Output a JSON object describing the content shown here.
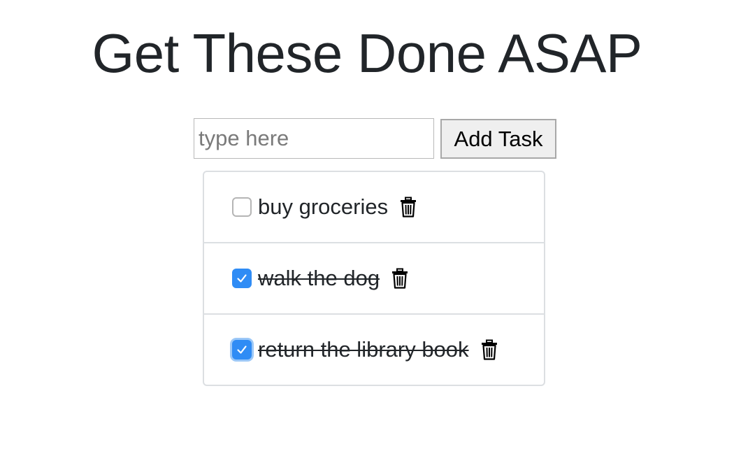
{
  "page": {
    "title": "Get These Done ASAP"
  },
  "form": {
    "input_value": "",
    "input_placeholder": "type here",
    "add_button_label": "Add Task"
  },
  "tasks": [
    {
      "label": "buy groceries",
      "completed": false,
      "delete_icon": "trash-icon"
    },
    {
      "label": "walk the dog",
      "completed": true,
      "delete_icon": "trash-icon"
    },
    {
      "label": "return the library book",
      "completed": true,
      "delete_icon": "trash-icon"
    }
  ],
  "colors": {
    "text": "#212529",
    "checkbox_checked": "#2f8cf5",
    "border": "#dcdfe2"
  }
}
